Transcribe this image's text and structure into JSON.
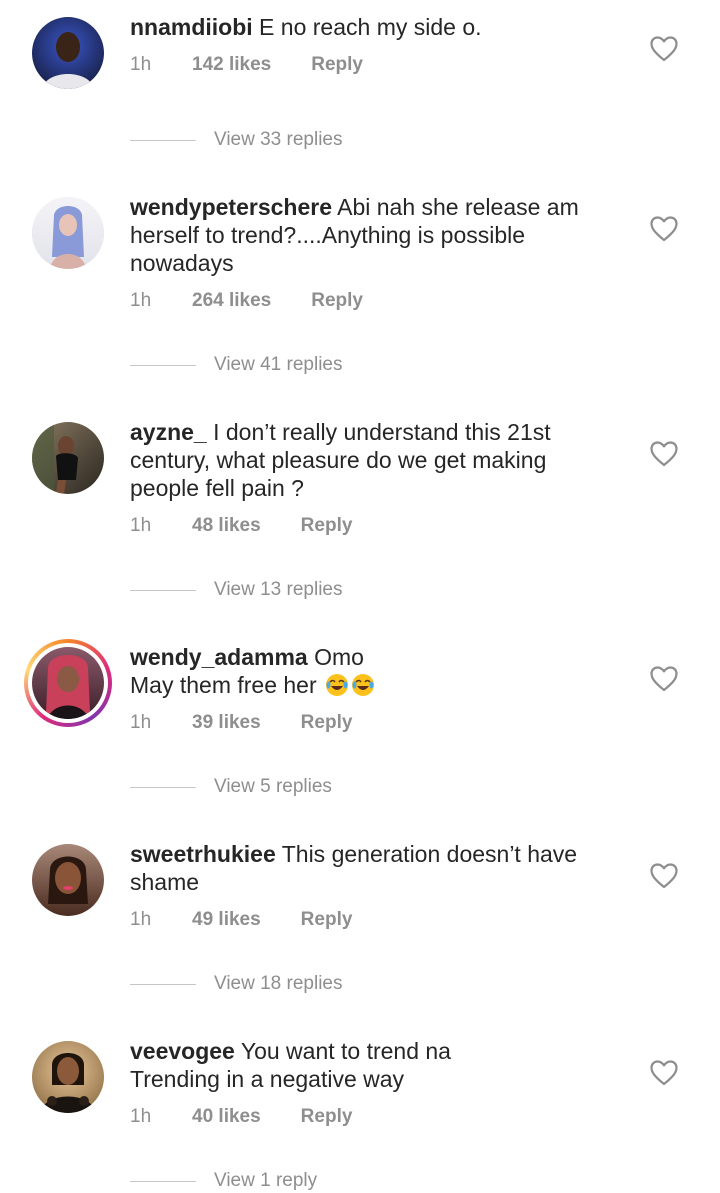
{
  "comments": [
    {
      "username": "nnamdiiobi",
      "text": " E no reach my side o.",
      "time": "1h",
      "likes": "142 likes",
      "reply": "Reply",
      "view_replies": "View 33 replies",
      "avatar_icon": "profile-photo",
      "avatar_colors": [
        "#2a3b8f",
        "#1b1f3a"
      ]
    },
    {
      "username": "wendypeterschere",
      "text": " Abi nah she release am herself to trend?....Anything is possible nowadays",
      "time": "1h",
      "likes": "264 likes",
      "reply": "Reply",
      "view_replies": "View 41 replies",
      "avatar_icon": "profile-photo",
      "avatar_colors": [
        "#c9b6e8",
        "#6a7fb8"
      ]
    },
    {
      "username": "ayzne_",
      "text": " I don’t really understand this 21st century, what pleasure do we get making people fell pain ?",
      "time": "1h",
      "likes": "48 likes",
      "reply": "Reply",
      "view_replies": "View 13 replies",
      "avatar_icon": "profile-photo",
      "avatar_colors": [
        "#6b5a4a",
        "#2d2a24"
      ]
    },
    {
      "username": "wendy_adamma",
      "text": " Omo",
      "text_line2": "May them free her ",
      "emoji": "face-with-tears-of-joy",
      "time": "1h",
      "likes": "39 likes",
      "reply": "Reply",
      "view_replies": "View 5 replies",
      "avatar_icon": "profile-photo",
      "avatar_colors": [
        "#c05a6a",
        "#5e2a38"
      ]
    },
    {
      "username": "sweetrhukiee",
      "text": " This generation doesn’t have shame",
      "time": "1h",
      "likes": "49 likes",
      "reply": "Reply",
      "view_replies": "View 18 replies",
      "avatar_icon": "profile-photo",
      "avatar_colors": [
        "#b47a5a",
        "#3e2418"
      ]
    },
    {
      "username": "veevogee",
      "text": " You want to trend na",
      "text_line2": "Trending in a negative way",
      "time": "1h",
      "likes": "40 likes",
      "reply": "Reply",
      "view_replies": "View 1 reply",
      "avatar_icon": "profile-photo",
      "avatar_colors": [
        "#c89a5a",
        "#3a2a1a"
      ]
    }
  ],
  "icons": {
    "like": "heart-icon"
  },
  "colors": {
    "text": "#262626",
    "secondary": "#8e8e8e",
    "divider": "#c7c7c7"
  }
}
